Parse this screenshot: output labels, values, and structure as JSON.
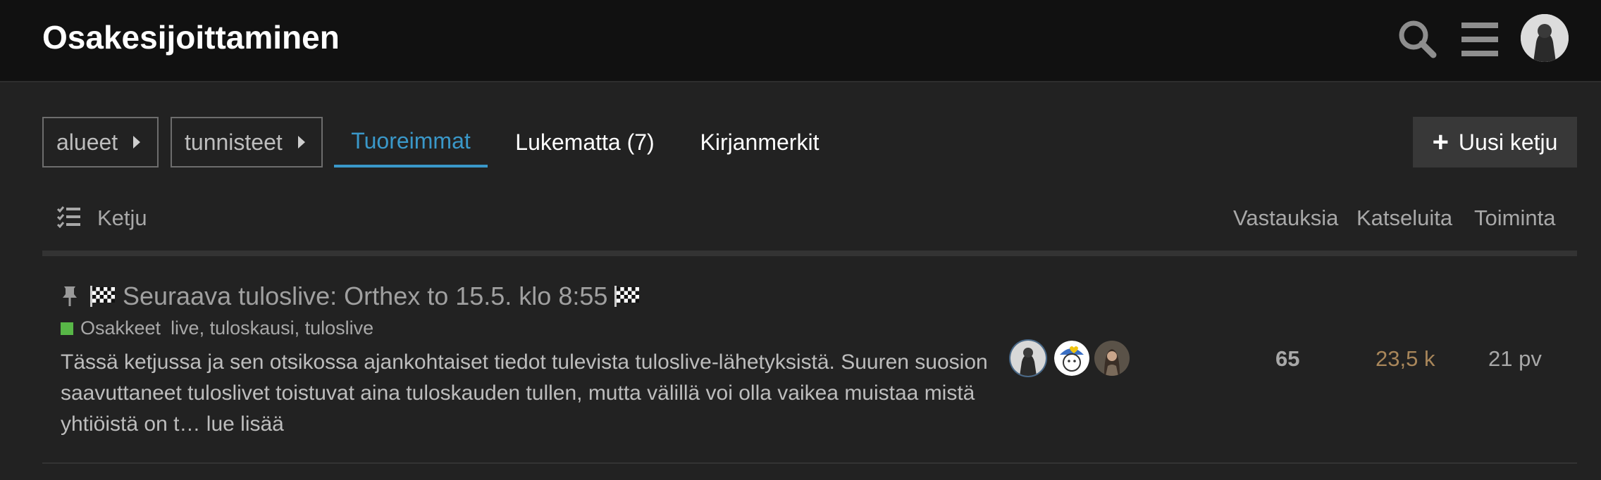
{
  "header": {
    "title": "Osakesijoittaminen",
    "icons": [
      "search-icon",
      "hamburger-menu-icon",
      "user-avatar"
    ]
  },
  "nav": {
    "dropdowns": [
      {
        "label": "alueet"
      },
      {
        "label": "tunnisteet"
      }
    ],
    "tabs": [
      {
        "label": "Tuoreimmat",
        "active": true
      },
      {
        "label": "Lukematta (7)",
        "active": false
      },
      {
        "label": "Kirjanmerkit",
        "active": false
      }
    ],
    "new_topic_label": "Uusi ketju"
  },
  "table": {
    "headers": {
      "topic": "Ketju",
      "replies": "Vastauksia",
      "views": "Katseluita",
      "activity": "Toiminta"
    },
    "rows": [
      {
        "pinned": true,
        "title": "Seuraava tuloslive: Orthex to 15.5. klo 8:55",
        "category": "Osakkeet",
        "category_color": "#58b747",
        "tags": "live, tuloskausi, tuloslive",
        "excerpt": "Tässä ketjussa ja sen otsikossa ajankohtaiset tiedot tulevista tuloslive-lähetyksistä. Suuren suosion saavuttaneet tuloslivet toistuvat aina tuloskauden tullen, mutta välillä voi olla vaikea muistaa mistä yhtiöistä on t…",
        "read_more": "lue lisää",
        "replies": "65",
        "views": "23,5 k",
        "views_color": "#a8865a",
        "activity": "21 pv"
      }
    ]
  },
  "colors": {
    "accent": "#3a98c9",
    "header_bg": "#111111",
    "page_bg": "#222222"
  }
}
